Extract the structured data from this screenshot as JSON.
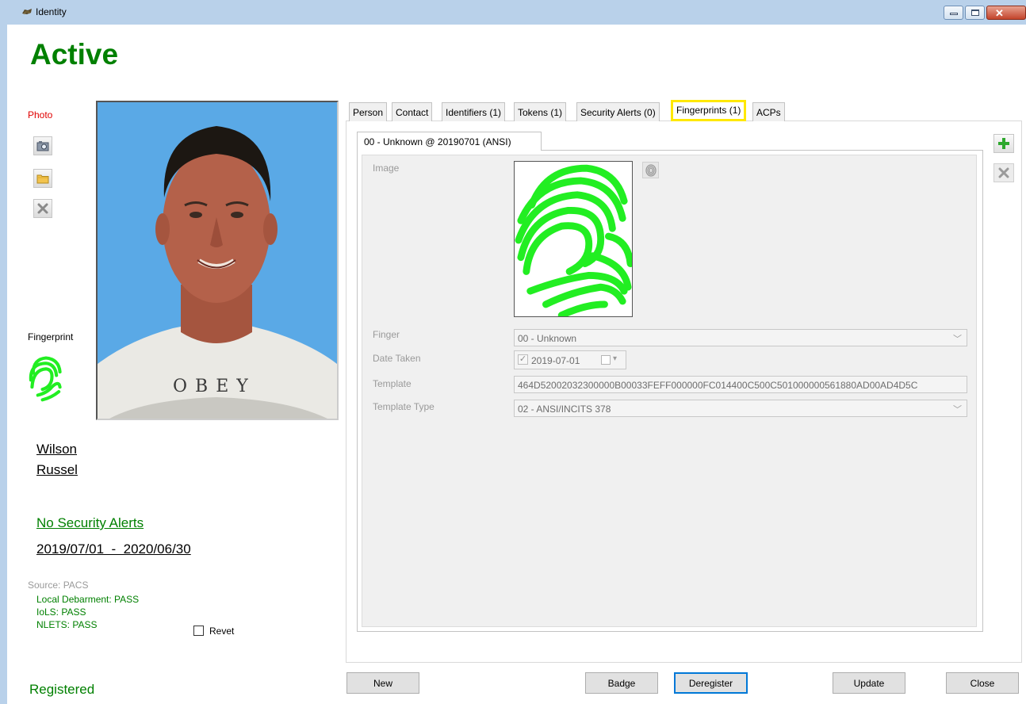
{
  "window": {
    "title": "Identity",
    "controls": {
      "minimize": "–",
      "maximize": "□",
      "close": "✕"
    }
  },
  "status": "Active",
  "left": {
    "photo_label": "Photo",
    "photo_buttons": [
      "camera-icon",
      "folder-icon",
      "delete-icon"
    ],
    "fingerprint_label": "Fingerprint",
    "last_name": "Wilson",
    "first_name": "Russel",
    "security_alerts_link": "No Security Alerts",
    "date_range": "2019/07/01  -  2020/06/30",
    "source": "Source: PACS",
    "checks": [
      "Local Debarment: PASS",
      "IoLS: PASS",
      "NLETS: PASS"
    ],
    "revet_label": "Revet",
    "revet_checked": false,
    "registration_status": "Registered"
  },
  "tabs": [
    {
      "label": "Person",
      "active": false
    },
    {
      "label": "Contact",
      "active": false
    },
    {
      "label": "Identifiers (1)",
      "active": false
    },
    {
      "label": "Tokens (1)",
      "active": false
    },
    {
      "label": "Security Alerts (0)",
      "active": false
    },
    {
      "label": "Fingerprints (1)",
      "active": true
    },
    {
      "label": "ACPs",
      "active": false
    }
  ],
  "fingerprint_record": {
    "subtab": "00 - Unknown @ 20190701 (ANSI)",
    "image_label": "Image",
    "finger_label": "Finger",
    "finger_value": "00 - Unknown",
    "date_taken_label": "Date Taken",
    "date_taken_value": "2019-07-01",
    "date_taken_checked": true,
    "template_label": "Template",
    "template_value": "464D52002032300000B00033FEFF000000FC014400C500C501000000561880AD00AD4D5C",
    "template_type_label": "Template Type",
    "template_type_value": "02 - ANSI/INCITS 378"
  },
  "colors": {
    "status_green": "#008000",
    "photo_label_red": "#e00000",
    "highlight_yellow": "#ffe800",
    "fingerprint_green": "#22ee22",
    "photo_background": "#5aa9e6"
  },
  "buttons": {
    "new": "New",
    "badge": "Badge",
    "deregister": "Deregister",
    "update": "Update",
    "close": "Close"
  }
}
